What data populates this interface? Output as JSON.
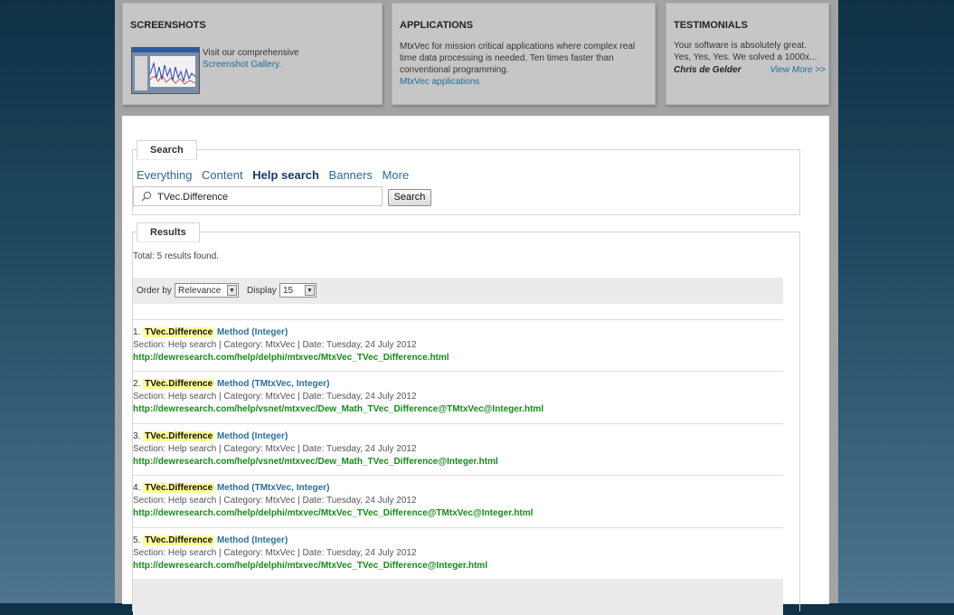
{
  "boxes": {
    "screenshots": {
      "title": "SCREENSHOTS",
      "text": "Visit our comprehensive",
      "link": "Screenshot Gallery."
    },
    "applications": {
      "title": "APPLICATIONS",
      "line1": "MtxVec for mission critical applications where complex real",
      "line2": "time data processing is needed. Ten times faster than",
      "line3": "conventional programming.",
      "link": "MtxVec applications"
    },
    "testimonials": {
      "title": "TESTIMONIALS",
      "line1": "Your software is absolutely great.",
      "line2": "Yes, Yes, Yes. We solved a 1000x...",
      "author": "Chris de Gelder",
      "link": "View More >>"
    }
  },
  "search": {
    "legend": "Search",
    "tabs": [
      "Everything",
      "Content",
      "Help search",
      "Banners",
      "More"
    ],
    "active_tab": "Help search",
    "query": "TVec.Difference",
    "button": "Search"
  },
  "results": {
    "legend": "Results",
    "total": "Total: 5 results found.",
    "order_label": "Order by",
    "order_value": "Relevance",
    "display_label": "Display",
    "display_value": "15",
    "items": [
      {
        "num": "1.",
        "hl": "TVec.Difference",
        "title": "Method (Integer)",
        "meta": "Section: Help search | Category: MtxVec | Date: Tuesday, 24 July 2012",
        "url": "http://dewresearch.com/help/delphi/mtxvec/MtxVec_TVec_Difference.html"
      },
      {
        "num": "2.",
        "hl": "TVec.Difference",
        "title": "Method (TMtxVec, Integer)",
        "meta": "Section: Help search | Category: MtxVec | Date: Tuesday, 24 July 2012",
        "url": "http://dewresearch.com/help/vsnet/mtxvec/Dew_Math_TVec_Difference@TMtxVec@Integer.html"
      },
      {
        "num": "3.",
        "hl": "TVec.Difference",
        "title": "Method (Integer)",
        "meta": "Section: Help search | Category: MtxVec | Date: Tuesday, 24 July 2012",
        "url": "http://dewresearch.com/help/vsnet/mtxvec/Dew_Math_TVec_Difference@Integer.html"
      },
      {
        "num": "4.",
        "hl": "TVec.Difference",
        "title": "Method (TMtxVec, Integer)",
        "meta": "Section: Help search | Category: MtxVec | Date: Tuesday, 24 July 2012",
        "url": "http://dewresearch.com/help/delphi/mtxvec/MtxVec_TVec_Difference@TMtxVec@Integer.html"
      },
      {
        "num": "5.",
        "hl": "TVec.Difference",
        "title": "Method (Integer)",
        "meta": "Section: Help search | Category: MtxVec | Date: Tuesday, 24 July 2012",
        "url": "http://dewresearch.com/help/delphi/mtxvec/MtxVec_TVec_Difference@Integer.html"
      }
    ]
  }
}
